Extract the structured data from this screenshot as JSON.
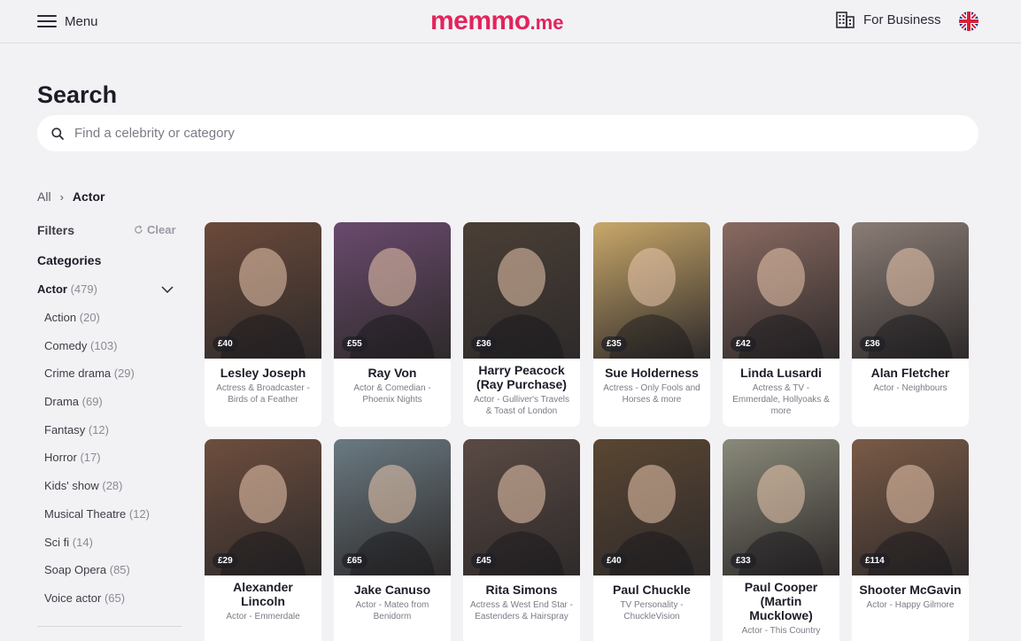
{
  "header": {
    "menu_label": "Menu",
    "logo_main": "memmo",
    "logo_sub": ".me",
    "business_label": "For Business",
    "brand_color": "#e2245d"
  },
  "search": {
    "title": "Search",
    "placeholder": "Find a celebrity or category",
    "value": ""
  },
  "breadcrumb": {
    "root": "All",
    "current": "Actor"
  },
  "sidebar": {
    "filters_label": "Filters",
    "clear_label": "Clear",
    "categories_label": "Categories",
    "parent": {
      "name": "Actor",
      "count": "(479)"
    },
    "items": [
      {
        "name": "Action",
        "count": "(20)"
      },
      {
        "name": "Comedy",
        "count": "(103)"
      },
      {
        "name": "Crime drama",
        "count": "(29)"
      },
      {
        "name": "Drama",
        "count": "(69)"
      },
      {
        "name": "Fantasy",
        "count": "(12)"
      },
      {
        "name": "Horror",
        "count": "(17)"
      },
      {
        "name": "Kids' show",
        "count": "(28)"
      },
      {
        "name": "Musical Theatre",
        "count": "(12)"
      },
      {
        "name": "Sci fi",
        "count": "(14)"
      },
      {
        "name": "Soap Opera",
        "count": "(85)"
      },
      {
        "name": "Voice actor",
        "count": "(65)"
      }
    ]
  },
  "celebrities": [
    {
      "name": "Lesley Joseph",
      "desc": "Actress & Broadcaster - Birds of a Feather",
      "price": "£40",
      "color": "#6b4a3a"
    },
    {
      "name": "Ray Von",
      "desc": "Actor & Comedian - Phoenix Nights",
      "price": "£55",
      "color": "#6a4a6e"
    },
    {
      "name": "Harry Peacock (Ray Purchase)",
      "desc": "Actor - Gulliver's Travels & Toast of London",
      "price": "£36",
      "color": "#4a3f36"
    },
    {
      "name": "Sue Holderness",
      "desc": "Actress - Only Fools and Horses & more",
      "price": "£35",
      "color": "#c9a86a"
    },
    {
      "name": "Linda Lusardi",
      "desc": "Actress & TV - Emmerdale, Hollyoaks & more",
      "price": "£42",
      "color": "#8a6a62"
    },
    {
      "name": "Alan Fletcher",
      "desc": "Actor - Neighbours",
      "price": "£36",
      "color": "#8a7d76"
    },
    {
      "name": "Alexander Lincoln",
      "desc": "Actor - Emmerdale",
      "price": "£29",
      "color": "#6e4e3e"
    },
    {
      "name": "Jake Canuso",
      "desc": "Actor - Mateo from Benidorm",
      "price": "£65",
      "color": "#6a7a82"
    },
    {
      "name": "Rita Simons",
      "desc": "Actress & West End Star - Eastenders & Hairspray",
      "price": "£45",
      "color": "#5a4a44"
    },
    {
      "name": "Paul Chuckle",
      "desc": "TV Personality - ChuckleVision",
      "price": "£40",
      "color": "#5a4632"
    },
    {
      "name": "Paul Cooper (Martin Mucklowe)",
      "desc": "Actor - This Country",
      "price": "£33",
      "color": "#8a8a7a"
    },
    {
      "name": "Shooter McGavin",
      "desc": "Actor - Happy Gilmore",
      "price": "£114",
      "color": "#7a5a46"
    }
  ]
}
